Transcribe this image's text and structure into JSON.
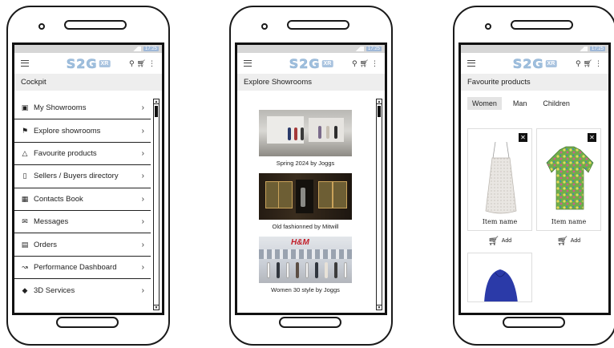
{
  "status": {
    "time": "17:25"
  },
  "logo": {
    "text": "S2G",
    "badge": "XR"
  },
  "icons": {
    "menu": "hamburger-icon",
    "search": "search-icon",
    "cart": "cart-icon",
    "more": "more-vert-icon"
  },
  "cockpit": {
    "title": "Cockpit",
    "items": [
      {
        "label": "My Showrooms",
        "icon": "showroom-icon"
      },
      {
        "label": "Explore showrooms",
        "icon": "flag-icon"
      },
      {
        "label": "Favourite products",
        "icon": "shirt-icon"
      },
      {
        "label": "Sellers / Buyers directory",
        "icon": "bookmark-icon"
      },
      {
        "label": "Contacts Book",
        "icon": "contact-book-icon"
      },
      {
        "label": "Messages",
        "icon": "mail-icon"
      },
      {
        "label": "Orders",
        "icon": "orders-icon"
      },
      {
        "label": "Performance Dashboard",
        "icon": "chart-icon"
      },
      {
        "label": "3D Services",
        "icon": "cube-icon"
      }
    ]
  },
  "explore": {
    "title": "Explore Showrooms",
    "cards": [
      {
        "caption": "Spring 2024 by Joggs"
      },
      {
        "caption": "Old fashionned by Mitwill"
      },
      {
        "caption": "Women 30 style by Joggs",
        "sign": "H&M"
      }
    ]
  },
  "favourites": {
    "title": "Favourite products",
    "tabs": [
      "Women",
      "Man",
      "Children"
    ],
    "active_tab": "Women",
    "products": [
      {
        "name": "Item name",
        "add_label": "Add"
      },
      {
        "name": "Item name",
        "add_label": "Add"
      }
    ]
  }
}
